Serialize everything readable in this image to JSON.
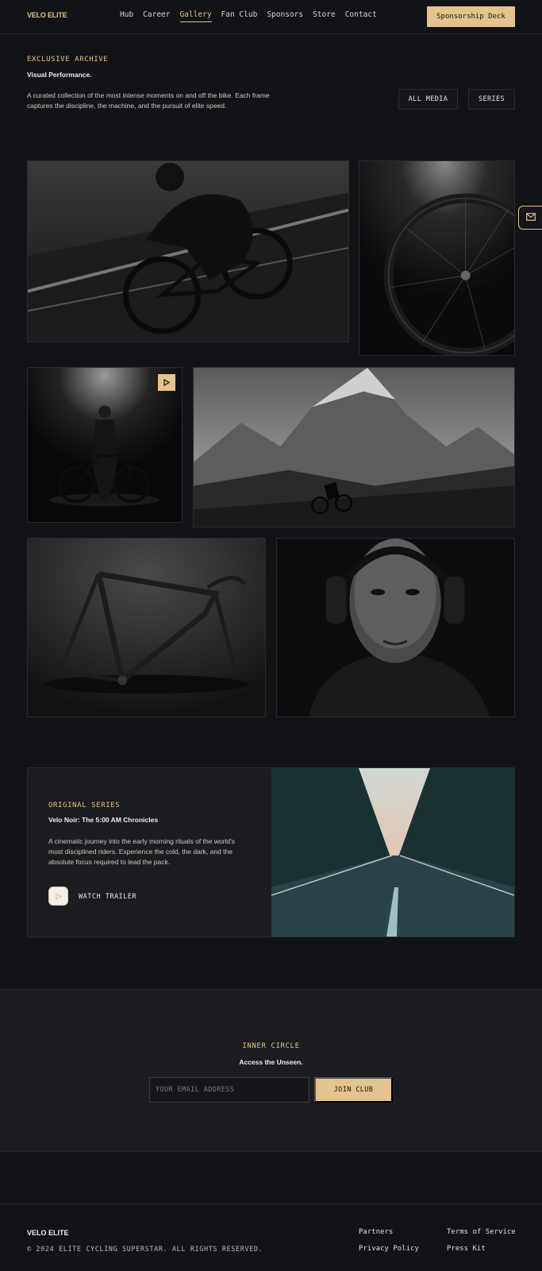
{
  "nav": {
    "brand": "VELO ELITE",
    "items": [
      "Hub",
      "Career",
      "Gallery",
      "Fan Club",
      "Sponsors",
      "Store",
      "Contact"
    ],
    "active": "Gallery",
    "cta": "Sponsorship Deck"
  },
  "hero": {
    "eyebrow": "EXCLUSIVE ARCHIVE",
    "title": "Visual Performance.",
    "description": "A curated collection of the most intense moments on and off the bike. Each frame captures the discipline, the machine, and the pursuit of elite speed.",
    "filters": [
      "ALL MEDIA",
      "SERIES"
    ]
  },
  "gallery": {
    "items": [
      {
        "name": "cyclist-racing-photo",
        "icon": "photo"
      },
      {
        "name": "wheel-closeup-photo",
        "icon": "photo"
      },
      {
        "name": "athlete-portrait-video",
        "icon": "play-icon"
      },
      {
        "name": "mountain-ride-photo",
        "icon": "photo"
      },
      {
        "name": "bike-frame-photo",
        "icon": "photo"
      },
      {
        "name": "athlete-headphones-photo",
        "icon": "photo"
      }
    ]
  },
  "series": {
    "eyebrow": "ORIGINAL SERIES",
    "title": "Velo Noir: The 5:00 AM Chronicles",
    "description": "A cinematic journey into the early morning rituals of the world's most disciplined riders. Experience the cold, the dark, and the absolute focus required to lead the pack.",
    "cta": "WATCH TRAILER"
  },
  "club": {
    "eyebrow": "INNER CIRCLE",
    "title": "Access the Unseen.",
    "email_placeholder": "YOUR EMAIL ADDRESS",
    "cta": "JOIN CLUB"
  },
  "footer": {
    "brand": "VELO ELITE",
    "copyright": "© 2024 ELITE CYCLING SUPERSTAR. ALL RIGHTS RESERVED.",
    "links": [
      "Partners",
      "Terms of Service",
      "Privacy Policy",
      "Press Kit"
    ]
  },
  "colors": {
    "accent": "#e2c48c",
    "background": "#121317",
    "panel": "#1b1c20"
  },
  "icons": {
    "mail": "mail-icon",
    "play": "play-icon"
  }
}
